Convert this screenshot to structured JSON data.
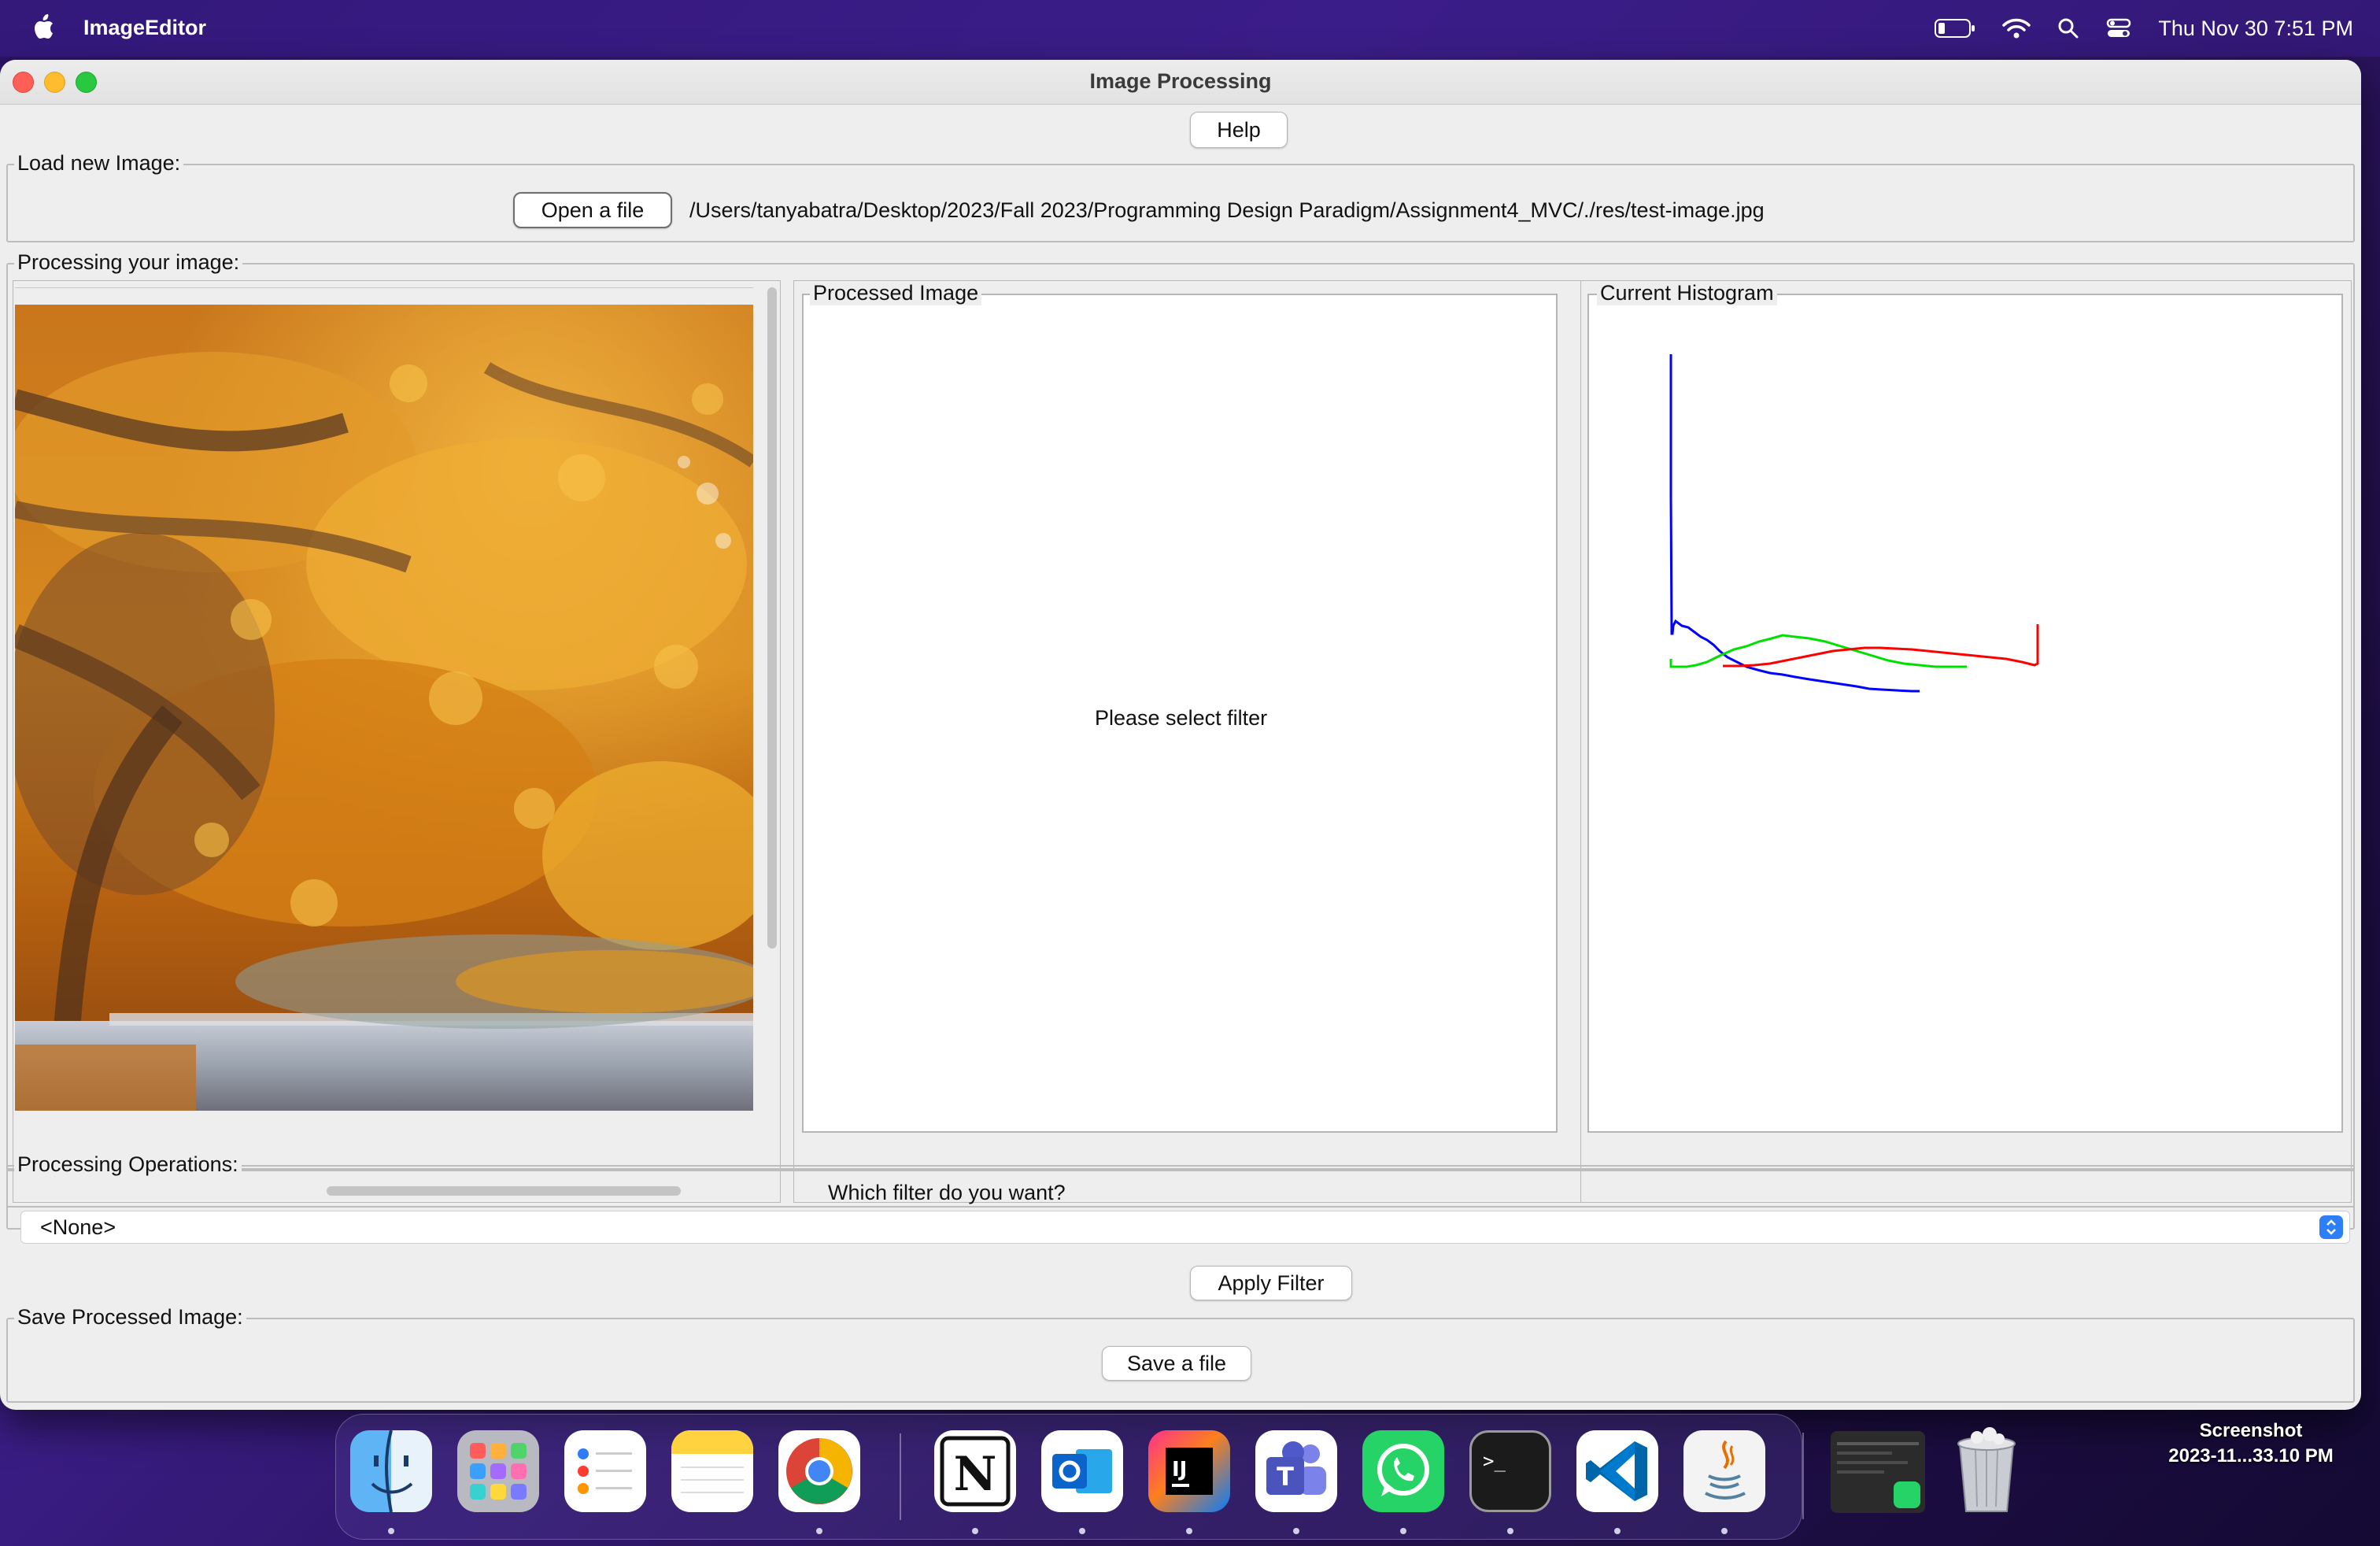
{
  "menubar": {
    "app_name": "ImageEditor",
    "datetime": "Thu Nov 30  7:51 PM"
  },
  "window": {
    "title": "Image Processing",
    "help_button": "Help",
    "load": {
      "group_title": "Load new Image:",
      "open_button": "Open a file",
      "file_path": "/Users/tanyabatra/Desktop/2023/Fall 2023/Programming Design Paradigm/Assignment4_MVC/./res/test-image.jpg"
    },
    "processing": {
      "group_title": "Processing your image:",
      "processed_title": "Processed Image",
      "processed_placeholder": "Please select filter",
      "histogram_title": "Current Histogram",
      "histogram_colors": {
        "red": "#ff0000",
        "green": "#00e000",
        "blue": "#0000ff"
      }
    },
    "operations": {
      "group_title": "Processing Operations:",
      "question": "Which filter do you want?",
      "selected_filter": "<None>",
      "apply_button": "Apply Filter"
    },
    "save": {
      "group_title": "Save Processed Image:",
      "save_button": "Save a file"
    }
  },
  "dock": {
    "items": [
      "finder-icon",
      "launchpad-icon",
      "reminders-icon",
      "notes-icon",
      "chrome-icon",
      "notion-icon",
      "outlook-icon",
      "intellij-icon",
      "teams-icon",
      "whatsapp-icon",
      "terminal-icon",
      "vscode-icon",
      "java-icon",
      "screenshot-thumbnail-icon",
      "trash-icon"
    ]
  },
  "desktop": {
    "screenshot_label_line1": "Screenshot",
    "screenshot_label_line2": "2023-11...33.10 PM"
  }
}
